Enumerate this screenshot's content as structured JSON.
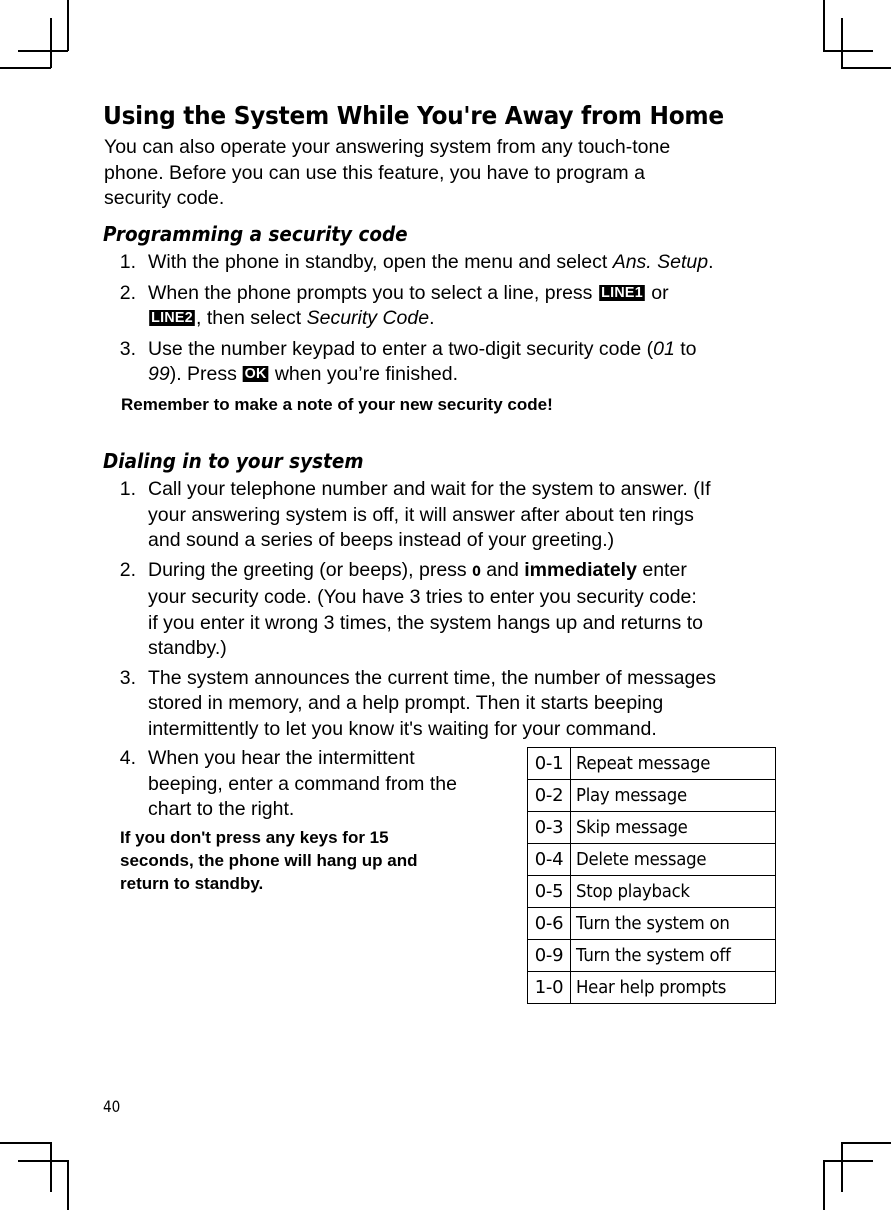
{
  "title": "Using the System While You're Away from Home",
  "intro_lines": [
    "You can also operate your answering system from any touch-tone",
    "phone. Before you can use this feature, you have to program a",
    "security code."
  ],
  "section1": {
    "heading": "Programming a security code",
    "steps": [
      {
        "num": "1.",
        "line1_a": "With the phone in standby, open the menu and select ",
        "line1_italic": "Ans. Setup",
        "line1_b": "."
      },
      {
        "num": "2.",
        "line1_a": "When the phone prompts you to select a line, press ",
        "key1": "LINE1",
        "line1_b": " or",
        "key2": "LINE2",
        "line2_a": ", then select ",
        "line2_italic": "Security Code",
        "line2_b": "."
      },
      {
        "num": "3.",
        "line1_a": "Use the number keypad to enter a two-digit security code (",
        "line1_italic": "01",
        "line1_b": " to",
        "line2_italic": "99",
        "line2_a": "). Press ",
        "key": "OK",
        "line2_b": " when you’re finished."
      }
    ],
    "note": "Remember to make a note of your new security code!"
  },
  "section2": {
    "heading": "Dialing in to your system",
    "steps": [
      {
        "num": "1.",
        "lines": [
          "Call your telephone number and wait for the system to answer. (If",
          "your answering system is off, it will answer after about ten rings",
          "and sound a series of beeps instead of your greeting.)"
        ]
      },
      {
        "num": "2.",
        "line1_a": "During the greeting (or beeps), press ",
        "key": "0",
        "line1_b": " and ",
        "line1_bold": "immediately",
        "line1_c": " enter",
        "lines_rest": [
          "your security code. (You have 3 tries to enter you security code:",
          "if you enter it wrong 3 times, the system hangs up and returns to",
          "standby.)"
        ]
      },
      {
        "num": "3.",
        "lines": [
          "The system announces the current time, the number of messages",
          "stored in memory, and a help prompt. Then it starts beeping",
          "intermittently to let you know it's waiting for your command."
        ]
      },
      {
        "num": "4.",
        "lines": [
          "When you hear the intermittent",
          "beeping, enter a command from the",
          "chart to the right."
        ]
      }
    ],
    "note_lines": [
      "If you don't press any keys for 15",
      "seconds, the phone will hang up and",
      "return to standby."
    ]
  },
  "commands": [
    {
      "code": "0-1",
      "action": "Repeat message"
    },
    {
      "code": "0-2",
      "action": "Play message"
    },
    {
      "code": "0-3",
      "action": "Skip message"
    },
    {
      "code": "0-4",
      "action": "Delete message"
    },
    {
      "code": "0-5",
      "action": "Stop playback"
    },
    {
      "code": "0-6",
      "action": "Turn the system on"
    },
    {
      "code": "0-9",
      "action": "Turn the system off"
    },
    {
      "code": "1-0",
      "action": "Hear help prompts"
    }
  ],
  "page_number": "40"
}
